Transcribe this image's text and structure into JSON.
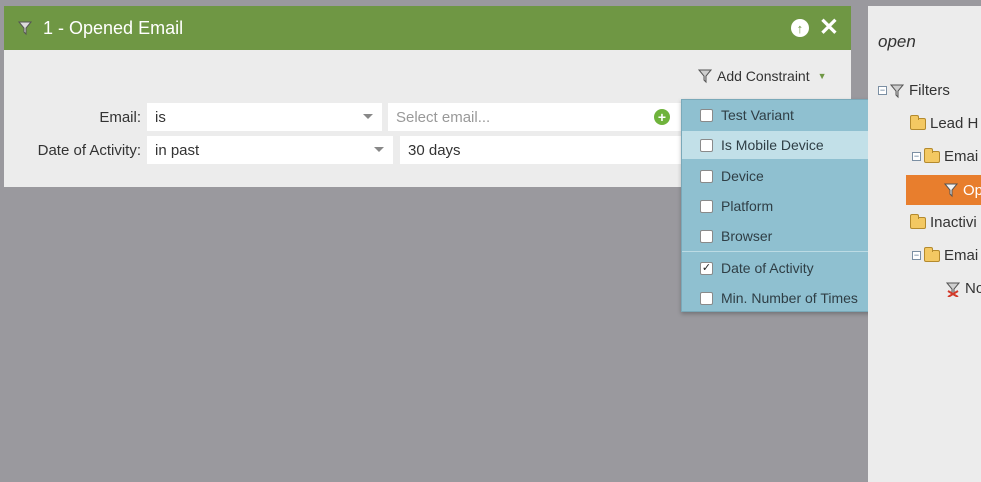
{
  "filter_card": {
    "title": "1 - Opened Email",
    "add_constraint_label": "Add Constraint",
    "rows": [
      {
        "label": "Email:",
        "operator": "is",
        "value_placeholder": "Select email..."
      },
      {
        "label": "Date of Activity:",
        "operator": "in past",
        "value": "30 days"
      }
    ]
  },
  "constraint_menu": {
    "items": [
      {
        "label": "Test Variant",
        "checked": false
      },
      {
        "label": "Is Mobile Device",
        "checked": false,
        "highlighted": true
      },
      {
        "label": "Device",
        "checked": false
      },
      {
        "label": "Platform",
        "checked": false
      },
      {
        "label": "Browser",
        "checked": false
      },
      {
        "label": "Date of Activity",
        "checked": true
      },
      {
        "label": "Min. Number of Times",
        "checked": false
      }
    ]
  },
  "tree_panel": {
    "search_text": "open",
    "nodes": [
      {
        "label": "Filters"
      },
      {
        "label": "Lead H"
      },
      {
        "label": "Emai"
      },
      {
        "label": "Op",
        "selected": true
      },
      {
        "label": "Inactivi"
      },
      {
        "label": "Emai"
      },
      {
        "label": "No"
      }
    ]
  },
  "colors": {
    "header_green": "#6f9744",
    "menu_blue": "#8fc0d0",
    "menu_highlight": "#c2e0e8",
    "selected_orange": "#e87e2d",
    "background_gray": "#9a999e"
  }
}
